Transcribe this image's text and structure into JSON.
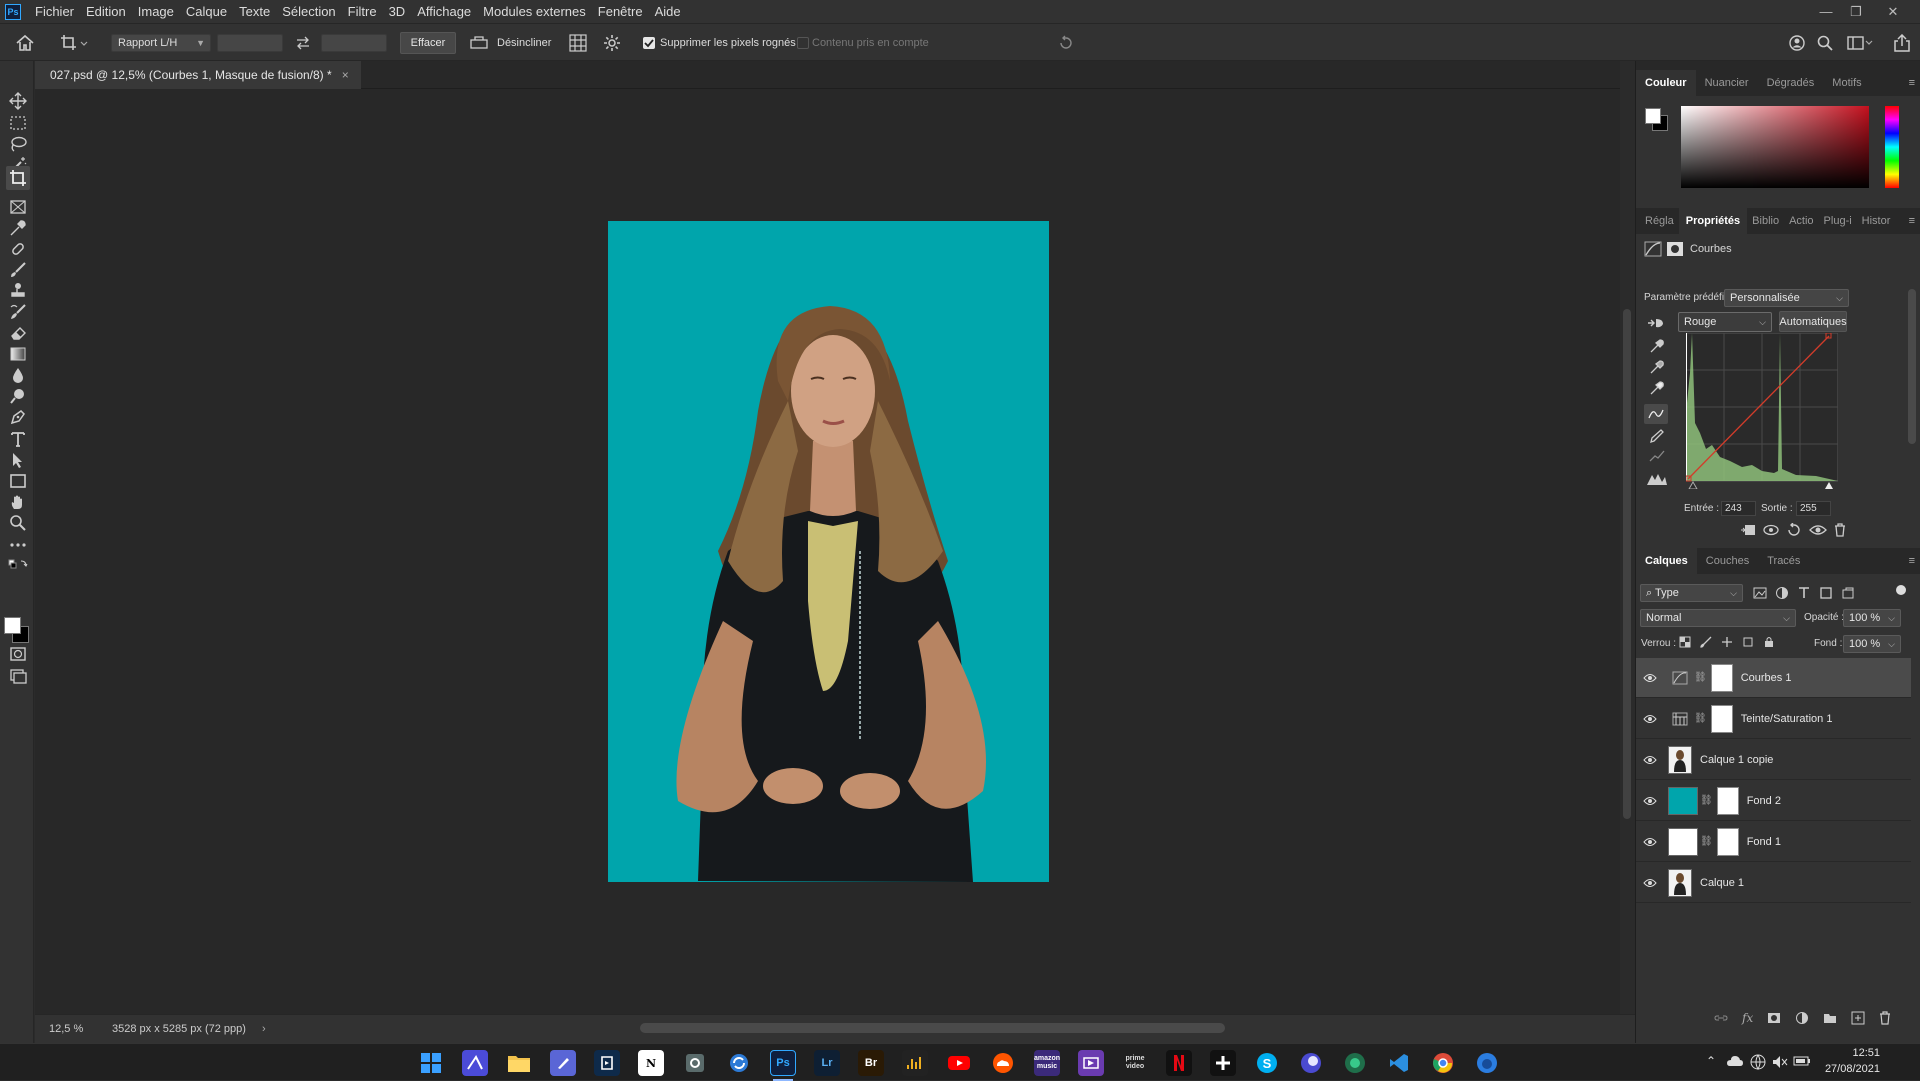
{
  "app": {
    "logo": "Ps"
  },
  "menu": [
    "Fichier",
    "Edition",
    "Image",
    "Calque",
    "Texte",
    "Sélection",
    "Filtre",
    "3D",
    "Affichage",
    "Modules externes",
    "Fenêtre",
    "Aide"
  ],
  "window_controls": {
    "minimize": "—",
    "restore": "❐",
    "close": "✕"
  },
  "options": {
    "ratio_label": "Rapport L/H",
    "effacer_label": "Effacer",
    "desincliner_label": "Désincliner",
    "supprimer_label": "Supprimer les pixels rognés",
    "supprimer_checked": true,
    "contenu_label": "Contenu pris en compte",
    "contenu_checked": false
  },
  "document": {
    "tab_title": "027.psd @ 12,5% (Courbes 1, Masque de fusion/8) *",
    "close_glyph": "×",
    "background_color": "#00a5ac"
  },
  "status": {
    "zoom": "12,5 %",
    "dimensions": "3528 px x 5285 px (72 ppp)",
    "arrow": "›"
  },
  "color_panel": {
    "tabs": [
      "Couleur",
      "Nuancier",
      "Dégradés",
      "Motifs"
    ],
    "active_tab": "Couleur",
    "hue": "#c4101e"
  },
  "properties_panel": {
    "tabs": [
      "Régla",
      "Propriétés",
      "Biblio",
      "Actio",
      "Plug-i",
      "Histor"
    ],
    "active_tab": "Propriétés",
    "title": "Courbes",
    "preset_label": "Paramètre prédéfini :",
    "preset_value": "Personnalisée",
    "channel": "Rouge",
    "auto_label": "Automatiques",
    "input_label": "Entrée :",
    "input_value": "243",
    "output_label": "Sortie :",
    "output_value": "255",
    "curve_color": "#d23c2a",
    "histogram_color": "#8ec07a"
  },
  "layers_panel": {
    "tabs": [
      "Calques",
      "Couches",
      "Tracés"
    ],
    "active_tab": "Calques",
    "filter_label": "Type",
    "blend_mode": "Normal",
    "opacity_label": "Opacité :",
    "opacity_value": "100 %",
    "lock_label": "Verrou :",
    "fill_label": "Fond :",
    "fill_value": "100 %",
    "layers": [
      {
        "name": "Courbes 1",
        "kind": "curves",
        "selected": true
      },
      {
        "name": "Teinte/Saturation 1",
        "kind": "huesat",
        "selected": false
      },
      {
        "name": "Calque 1 copie",
        "kind": "photo",
        "selected": false
      },
      {
        "name": "Fond 2",
        "kind": "fill-teal",
        "selected": false
      },
      {
        "name": "Fond 1",
        "kind": "fill-white",
        "selected": false
      },
      {
        "name": "Calque 1",
        "kind": "photo",
        "selected": false
      }
    ],
    "fond2_color": "#00a5ac"
  },
  "taskbar": {
    "clock_time": "12:51",
    "clock_date": "27/08/2021",
    "app_labels": {
      "ps": "Ps",
      "lr": "Lr",
      "br": "Br",
      "notion": "N",
      "prime": "prime video",
      "amazon": "amazon music"
    }
  }
}
